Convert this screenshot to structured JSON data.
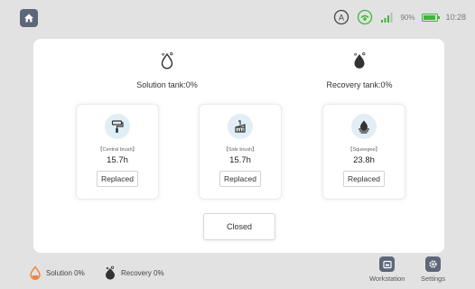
{
  "status_bar": {
    "home_icon": "home-icon",
    "auto_icon": "auto-mode-icon",
    "auto_label": "A",
    "network_icon": "network-icon",
    "signal_icon": "signal-icon",
    "battery_text": "90%",
    "battery_level": 0.9,
    "time": "10:28",
    "accent_color": "#3bb83b"
  },
  "dialog": {
    "solution_tank": {
      "icon": "water-drop-icon",
      "label": "Solution tank:0%"
    },
    "recovery_tank": {
      "icon": "dirty-water-drop-icon",
      "label": "Recovery tank:0%"
    },
    "cards": [
      {
        "icon": "roller-brush-icon",
        "name": "【Central brush】",
        "hours": "15.7h",
        "button": "Replaced"
      },
      {
        "icon": "side-brush-icon",
        "name": "【Side brush】",
        "hours": "15.7h",
        "button": "Replaced"
      },
      {
        "icon": "squeegee-icon",
        "name": "【Squeegee】",
        "hours": "23.8h",
        "button": "Replaced"
      }
    ],
    "close_button": "Closed"
  },
  "bottom_bar": {
    "solution": "Solution 0%",
    "recovery": "Recovery 0%",
    "workstation": "Workstation",
    "settings": "Settings"
  }
}
